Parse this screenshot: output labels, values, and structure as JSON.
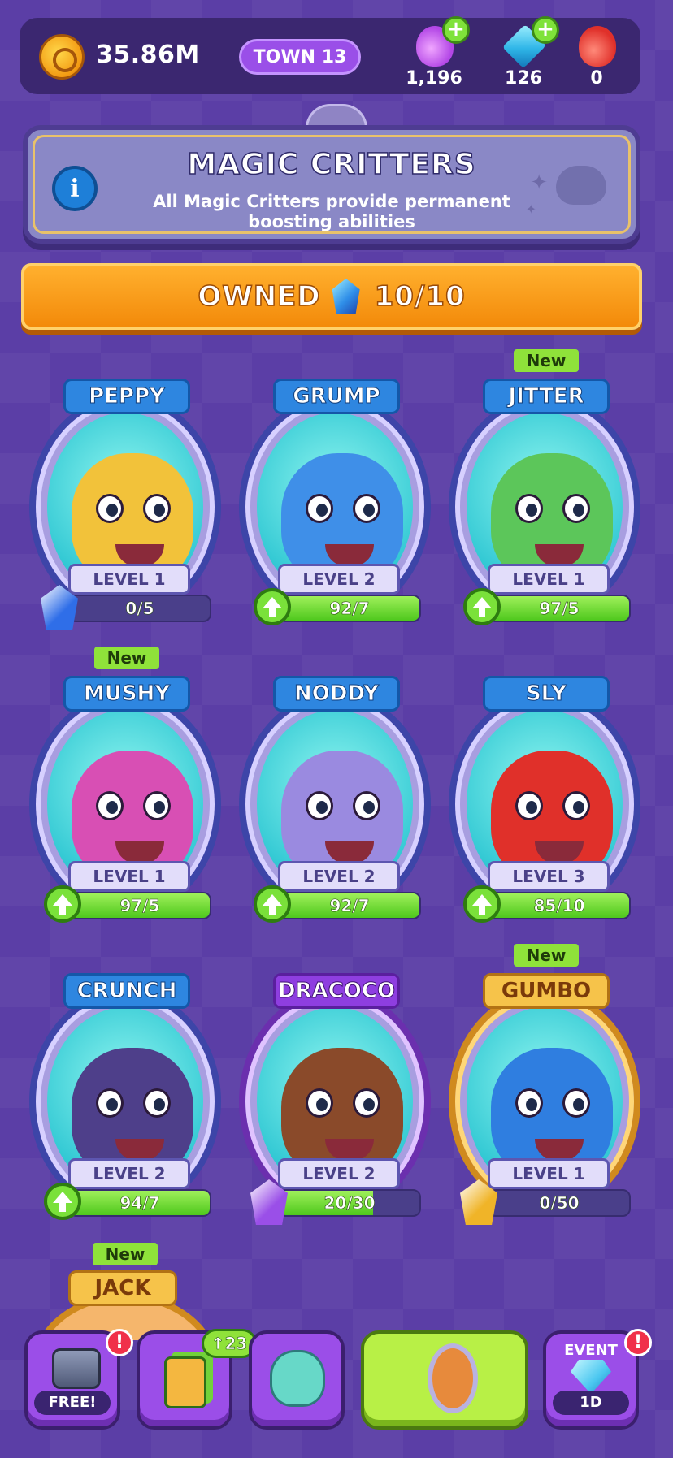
{
  "resources": {
    "coins": "35.86M",
    "town": "TOWN 13",
    "potion_purple": "1,196",
    "gems": "126",
    "potion_red": "0"
  },
  "banner": {
    "title": "MAGIC CRITTERS",
    "description": "All Magic Critters provide permanent boosting abilities"
  },
  "owned": {
    "label": "OWNED",
    "count": "10/10"
  },
  "critters": [
    {
      "name": "PEPPY",
      "level": "LEVEL 1",
      "progress": "0/5",
      "new": false,
      "upgradable": false,
      "fill": 0.0,
      "shard_color": "#2f6ee8",
      "body_color": "#f2c23a"
    },
    {
      "name": "GRUMP",
      "level": "LEVEL 2",
      "progress": "92/7",
      "new": false,
      "upgradable": true,
      "fill": 1.0,
      "body_color": "#3f8fe8"
    },
    {
      "name": "JITTER",
      "level": "LEVEL 1",
      "progress": "97/5",
      "new": true,
      "new_label": "New",
      "upgradable": true,
      "fill": 1.0,
      "body_color": "#5cc65a"
    },
    {
      "name": "MUSHY",
      "level": "LEVEL 1",
      "progress": "97/5",
      "new": true,
      "new_label": "New",
      "upgradable": true,
      "fill": 1.0,
      "body_color": "#d84fb4"
    },
    {
      "name": "NODDY",
      "level": "LEVEL 2",
      "progress": "92/7",
      "new": false,
      "upgradable": true,
      "fill": 1.0,
      "body_color": "#9a8ae0"
    },
    {
      "name": "SLY",
      "level": "LEVEL 3",
      "progress": "85/10",
      "new": false,
      "upgradable": true,
      "fill": 1.0,
      "body_color": "#e0302a"
    },
    {
      "name": "CRUNCH",
      "level": "LEVEL 2",
      "progress": "94/7",
      "new": false,
      "upgradable": true,
      "fill": 1.0,
      "body_color": "#4e3f8a"
    },
    {
      "name": "DRACOCO",
      "level": "LEVEL 2",
      "progress": "20/30",
      "new": false,
      "upgradable": false,
      "fill": 0.667,
      "shard_color": "#9a4fe8",
      "body_color": "#8a4a2a"
    },
    {
      "name": "GUMBO",
      "level": "LEVEL 1",
      "progress": "0/50",
      "new": true,
      "new_label": "New",
      "upgradable": false,
      "fill": 0.0,
      "shard_color": "#f0b428",
      "body_color": "#2f7ee0"
    }
  ],
  "partial_critter": {
    "name": "JACK",
    "new_label": "New"
  },
  "nav": {
    "shop_label": "FREE!",
    "cards_badge": "↑23",
    "event_title": "EVENT",
    "event_timer": "1D",
    "alert": "!"
  },
  "colors": {
    "background": "#5b3ea6",
    "accent_orange": "#f38a0a",
    "progress_green": "#4ec81d",
    "name_tag_blue": "#2e86e0"
  }
}
